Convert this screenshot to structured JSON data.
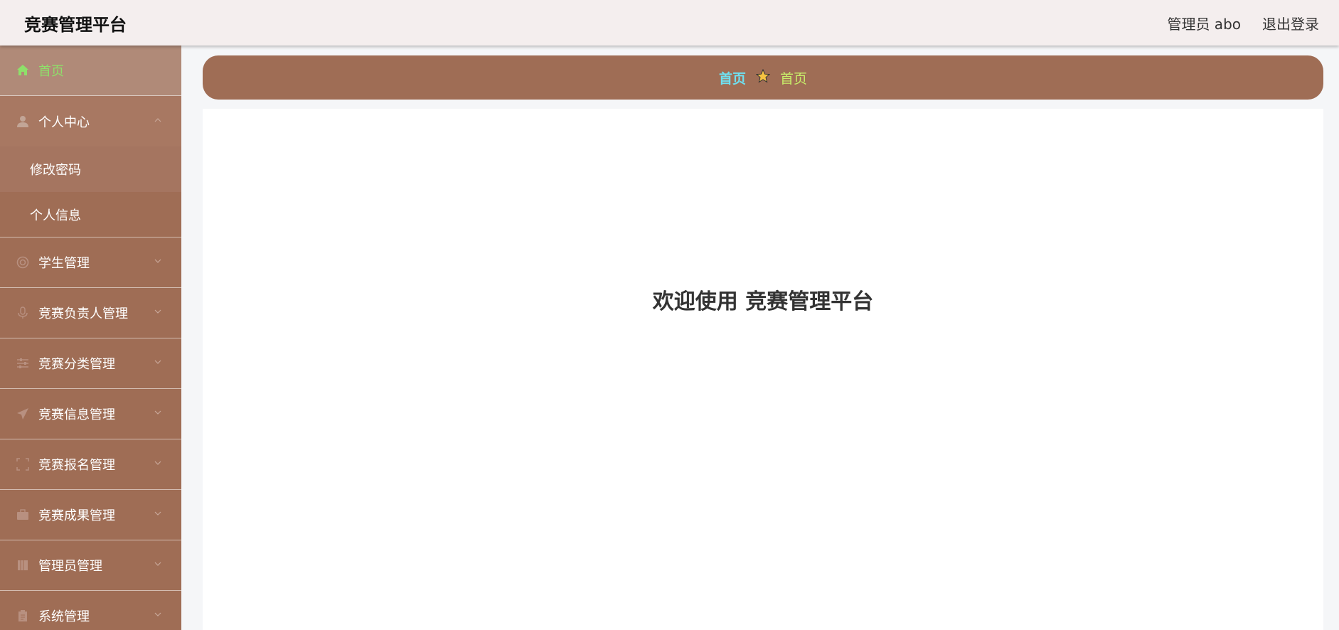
{
  "header": {
    "brand": "竞赛管理平台",
    "user": "管理员 abo",
    "logout": "退出登录"
  },
  "sidebar": {
    "items": [
      {
        "label": "首页",
        "icon": "home-icon"
      },
      {
        "label": "个人中心",
        "icon": "user-icon",
        "open": true,
        "children": [
          {
            "label": "修改密码"
          },
          {
            "label": "个人信息"
          }
        ]
      },
      {
        "label": "学生管理",
        "icon": "lifebuoy-icon"
      },
      {
        "label": "竞赛负责人管理",
        "icon": "microphone-icon"
      },
      {
        "label": "竞赛分类管理",
        "icon": "sliders-icon"
      },
      {
        "label": "竞赛信息管理",
        "icon": "paper-plane-icon"
      },
      {
        "label": "竞赛报名管理",
        "icon": "fullscreen-icon"
      },
      {
        "label": "竞赛成果管理",
        "icon": "briefcase-icon"
      },
      {
        "label": "管理员管理",
        "icon": "book-icon"
      },
      {
        "label": "系统管理",
        "icon": "clipboard-icon"
      }
    ]
  },
  "breadcrumb": {
    "first": "首页",
    "second": "首页",
    "separator_icon": "star-icon"
  },
  "main": {
    "welcome": "欢迎使用 竞赛管理平台"
  },
  "colors": {
    "sidebar": "#9f6d55",
    "home_active": "#8ee06a",
    "crumb_link": "#6fe0f0",
    "crumb_current": "#c8ef6a",
    "topbar": "#f4eeee"
  }
}
